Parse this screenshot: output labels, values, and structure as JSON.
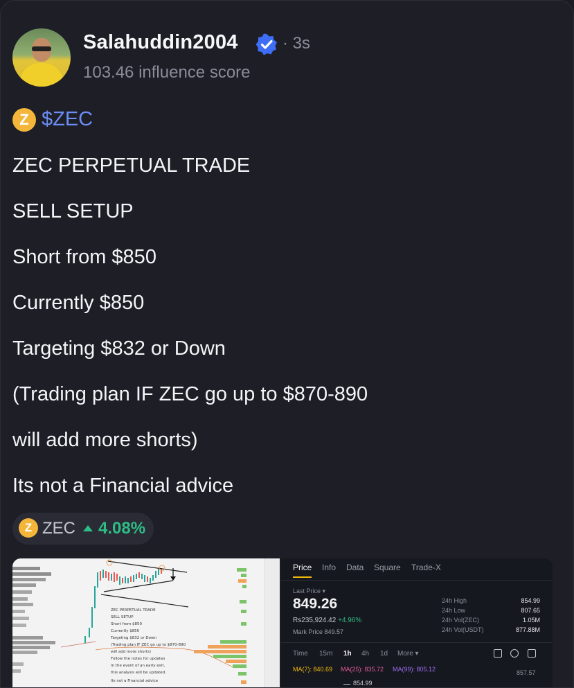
{
  "post": {
    "username": "Salahuddin2004",
    "time": "· 3s",
    "influence": "103.46 influence score",
    "cashtag": "$ZEC",
    "lines": [
      "ZEC PERPETUAL TRADE",
      "SELL SETUP",
      "Short from $850",
      "Currently $850",
      "Targeting $832 or Down",
      "(Trading plan IF ZEC go up to $870-890",
      "will add more shorts)",
      "Its not a Financial advice"
    ],
    "coin_glyph": "Z",
    "chip": {
      "symbol": "ZEC",
      "change": "4.08%",
      "direction": "up"
    }
  },
  "media": {
    "chart_notes": [
      "ZEC PERPETUAL TRADE",
      "SELL SETUP",
      "Short from $850",
      "Currently $850",
      "Targeting $832 or Down",
      "(Trading plan IF ZEC go up to $870-890",
      "will add more shorts)",
      "Follow the notes for updates",
      "In the event of an early exit,",
      "this analysis will be updated.",
      "Its not a Financial advice"
    ],
    "tabs": [
      "Price",
      "Info",
      "Data",
      "Square",
      "Trade-X"
    ],
    "last_price_label": "Last Price ▾",
    "last_price": "849.26",
    "fiat_value": "Rs235,924.42",
    "change": "+4.96%",
    "mark_price": "Mark Price  849.57",
    "stats": [
      {
        "label": "24h High",
        "value": "854.99"
      },
      {
        "label": "24h Low",
        "value": "807.65"
      },
      {
        "label": "24h Vol(ZEC)",
        "value": "1.05M"
      },
      {
        "label": "24h Vol(USDT)",
        "value": "877.88M"
      }
    ],
    "timeframes": [
      "Time",
      "15m",
      "1h",
      "4h",
      "1d",
      "More ▾"
    ],
    "ma7": "MA(7): 840.69",
    "ma25": "MA(25): 835.72",
    "ma99": "MA(99): 805.12",
    "axis_price": "857.57",
    "high_marker": "854.99"
  },
  "colors": {
    "background": "#1d1e26",
    "link": "#6c8df6",
    "up": "#2ebd85",
    "coin": "#f4b63a",
    "verified": "#3d6ef5"
  }
}
